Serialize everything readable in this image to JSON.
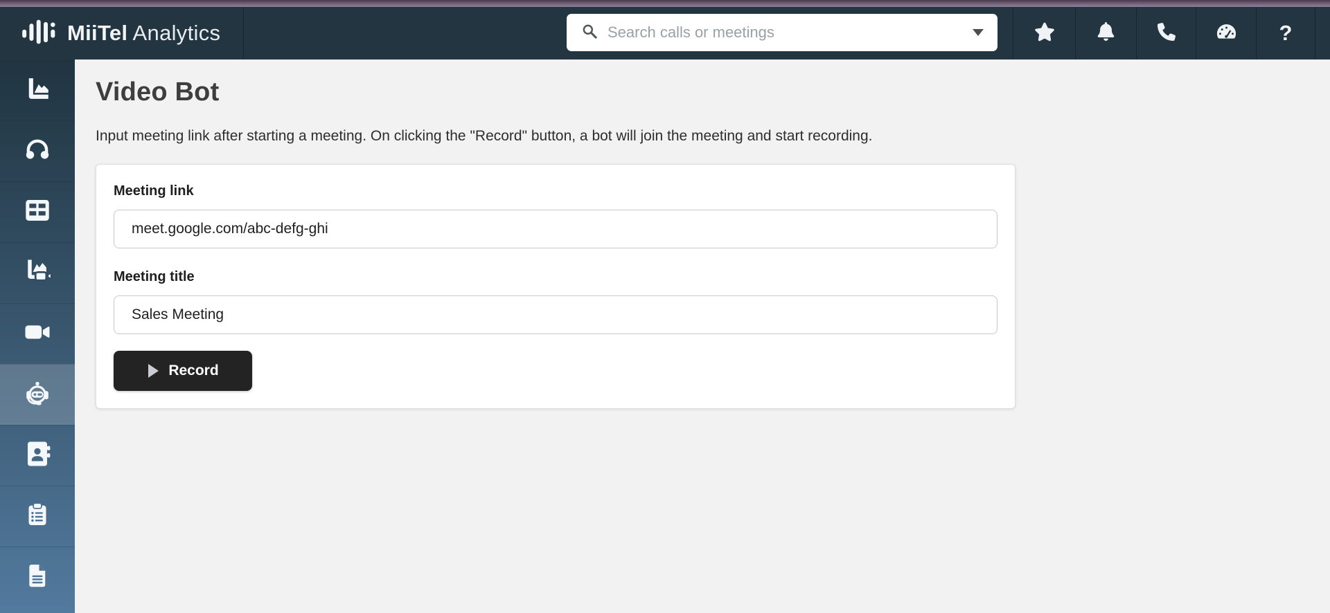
{
  "topbar": {
    "brand": {
      "name": "MiiTel",
      "product": "Analytics",
      "logo_icon": "waveform-icon"
    },
    "search": {
      "placeholder": "Search calls or meetings",
      "leading_icon": "search-icon",
      "trailing_icon": "caret-down-icon"
    },
    "actions": [
      {
        "icon": "star-icon"
      },
      {
        "icon": "bell-icon"
      },
      {
        "icon": "phone-icon"
      },
      {
        "icon": "gauge-icon"
      },
      {
        "icon": "question-mark-icon",
        "glyph": "?"
      }
    ]
  },
  "sidebar": {
    "items": [
      {
        "icon": "area-chart-icon",
        "active": false
      },
      {
        "icon": "headphones-icon",
        "active": false
      },
      {
        "icon": "table-grid-icon",
        "active": false
      },
      {
        "icon": "video-chart-icon",
        "active": false
      },
      {
        "icon": "video-camera-icon",
        "active": false
      },
      {
        "icon": "robot-headset-icon",
        "active": true
      },
      {
        "icon": "address-book-icon",
        "active": false
      },
      {
        "icon": "clipboard-list-icon",
        "active": false
      },
      {
        "icon": "document-icon",
        "active": false
      }
    ]
  },
  "main": {
    "title": "Video Bot",
    "description": "Input meeting link after starting a meeting. On clicking the \"Record\" button, a bot will join the meeting and start recording.",
    "form": {
      "meeting_link_label": "Meeting link",
      "meeting_link_value": "meet.google.com/abc-defg-ghi",
      "meeting_title_label": "Meeting title",
      "meeting_title_value": "Sales Meeting",
      "record_label": "Record"
    }
  },
  "colors": {
    "topbar_bg": "#233541",
    "sidebar_gradient_top": "#203440",
    "sidebar_gradient_bottom": "#527A9E",
    "active_item_overlay": "rgba(255,255,255,0.18)",
    "main_bg": "#F2F2F3",
    "record_button_bg": "#232323",
    "title_strip": "#6d5c73"
  }
}
